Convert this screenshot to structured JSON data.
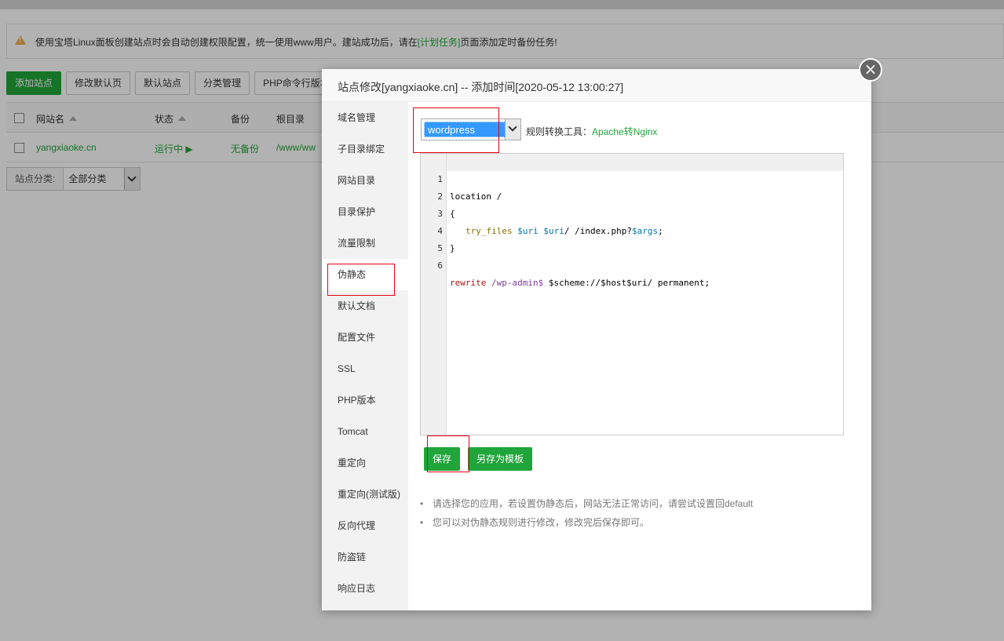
{
  "notice": {
    "text_before": "使用宝塔Linux面板创建站点时会自动创建权限配置，统一使用www用户。建站成功后，请在",
    "link": "[计划任务]",
    "text_after": "页面添加定时备份任务!"
  },
  "toolbar": {
    "add_site": "添加站点",
    "edit_default_page": "修改默认页",
    "default_site": "默认站点",
    "category_manage": "分类管理",
    "php_cli_version": "PHP命令行版本"
  },
  "table": {
    "headers": {
      "site_name": "网站名",
      "status": "状态",
      "backup": "备份",
      "root_dir": "根目录"
    },
    "rows": [
      {
        "site_name": "yangxiaoke.cn",
        "status": "运行中 ▶",
        "backup": "无备份",
        "root_dir": "/www/ww"
      }
    ]
  },
  "category": {
    "label": "站点分类:",
    "selected": "全部分类"
  },
  "modal": {
    "title": "站点修改[yangxiaoke.cn] -- 添加时间[2020-05-12 13:00:27]",
    "close_symbol": "×",
    "menu": [
      "域名管理",
      "子目录绑定",
      "网站目录",
      "目录保护",
      "流量限制",
      "伪静态",
      "默认文档",
      "配置文件",
      "SSL",
      "PHP版本",
      "Tomcat",
      "重定向",
      "重定向(测试版)",
      "反向代理",
      "防盗链",
      "响应日志"
    ],
    "active_menu": "伪静态",
    "rewrite_select": "wordpress",
    "tool_label": "规则转换工具：",
    "tool_link": "Apache转Nginx",
    "editor_lines": [
      {
        "no": "1",
        "text": "location /"
      },
      {
        "no": "2",
        "text": "{"
      },
      {
        "no": "3",
        "kw": "try_files",
        "v1": "$uri",
        "v2": "$uri",
        "rest": "/ /index.php?",
        "v3": "$args",
        "end": ";"
      },
      {
        "no": "4",
        "text": "}"
      },
      {
        "no": "5",
        "text": ""
      },
      {
        "no": "6",
        "kw": "rewrite",
        "path": "/wp-admin$",
        "rest": "$scheme://$host$uri/ permanent;"
      }
    ],
    "save_button": "保存",
    "save_template_button": "另存为模板",
    "tips": [
      "请选择您的应用，若设置伪静态后，网站无法正常访问，请尝试设置回default",
      "您可以对伪静态规则进行修改，修改完后保存即可。"
    ]
  },
  "colors": {
    "brand_green": "#20a53a",
    "highlight_red": "#e60012",
    "select_blue": "#3399ff"
  }
}
